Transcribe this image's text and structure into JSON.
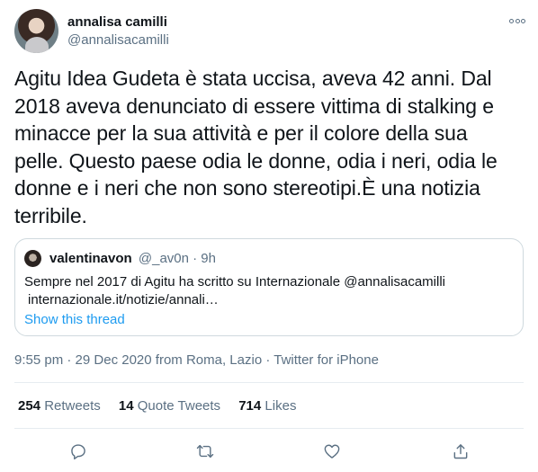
{
  "author": {
    "display_name": "annalisa camilli",
    "handle": "@annalisacamilli"
  },
  "tweet_text": "Agitu Idea Gudeta è stata uccisa, aveva 42 anni. Dal 2018 aveva denunciato di essere vittima di stalking e minacce per la sua attività e per il colore della sua pelle. Questo paese odia le donne, odia i neri, odia le donne e i neri che non sono stereotipi.È una notizia terribile.",
  "quoted_tweet": {
    "display_name": "valentinavon",
    "handle": "@_av0n · 9h",
    "text": "Sempre nel 2017 di Agitu ha scritto su Internazionale @annalisacamilli",
    "link": "internazionale.it/notizie/annali…",
    "show_thread": "Show this thread"
  },
  "meta": {
    "time": "9:55 pm",
    "date": "29 Dec 2020",
    "location": "from Roma, Lazio",
    "source": "Twitter for iPhone",
    "separator": " · "
  },
  "stats": {
    "retweets_count": "254",
    "retweets_label": "Retweets",
    "quote_tweets_count": "14",
    "quote_tweets_label": "Quote Tweets",
    "likes_count": "714",
    "likes_label": "Likes"
  },
  "icons": {
    "more": "more-horizontal-icon",
    "reply": "reply-icon",
    "retweet": "retweet-icon",
    "like": "heart-icon",
    "share": "share-icon"
  },
  "colors": {
    "text": "#0f1419",
    "secondary": "#5b7083",
    "link": "#1d9bf0",
    "border": "#cfd9de"
  }
}
